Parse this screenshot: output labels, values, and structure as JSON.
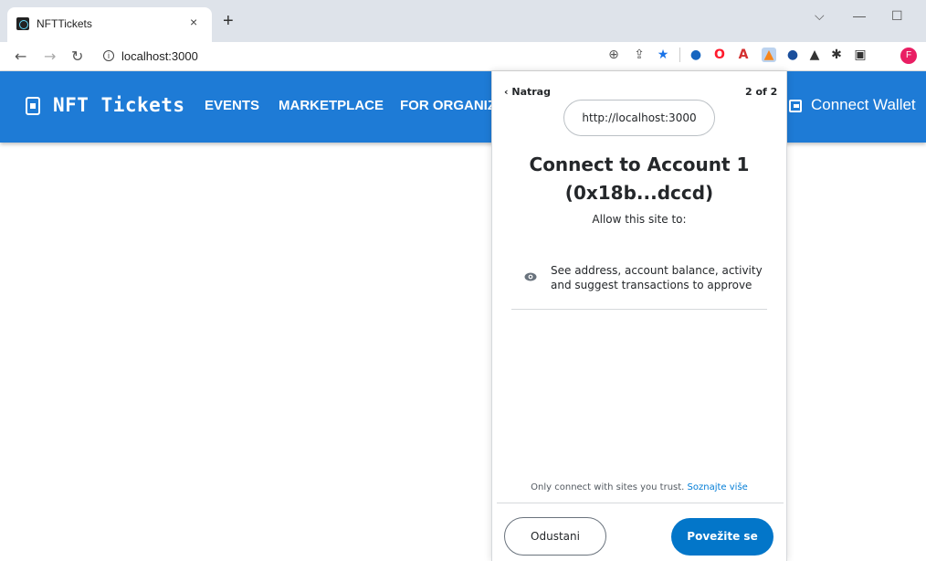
{
  "browser": {
    "tab_title": "NFTTickets",
    "tab_close": "×",
    "new_tab": "+",
    "url": "localhost:3000",
    "profile_initial": "F",
    "window_controls": {
      "minimize_chevron": "⌵",
      "minimize": "—",
      "maximize": "☐"
    }
  },
  "app": {
    "brand": "NFT Tickets",
    "nav": {
      "events": "EVENTS",
      "marketplace": "MARKETPLACE",
      "organizers": "FOR ORGANIZERS"
    },
    "connect_wallet": "Connect Wallet",
    "header_color": "#1e7bd6"
  },
  "popup": {
    "back_label": "Natrag",
    "step": "2 of 2",
    "origin": "http://localhost:3000",
    "title_line1": "Connect to Account 1",
    "title_line2": "(0x18b...dccd)",
    "allow_label": "Allow this site to:",
    "permission": "See address, account balance, activity and suggest transactions to approve",
    "trust_notice": "Only connect with sites you trust.",
    "learn_more": "Soznajte više",
    "cancel_label": "Odustani",
    "connect_label": "Povežite se",
    "primary_color": "#0376c9",
    "link_color": "#037dd6"
  }
}
